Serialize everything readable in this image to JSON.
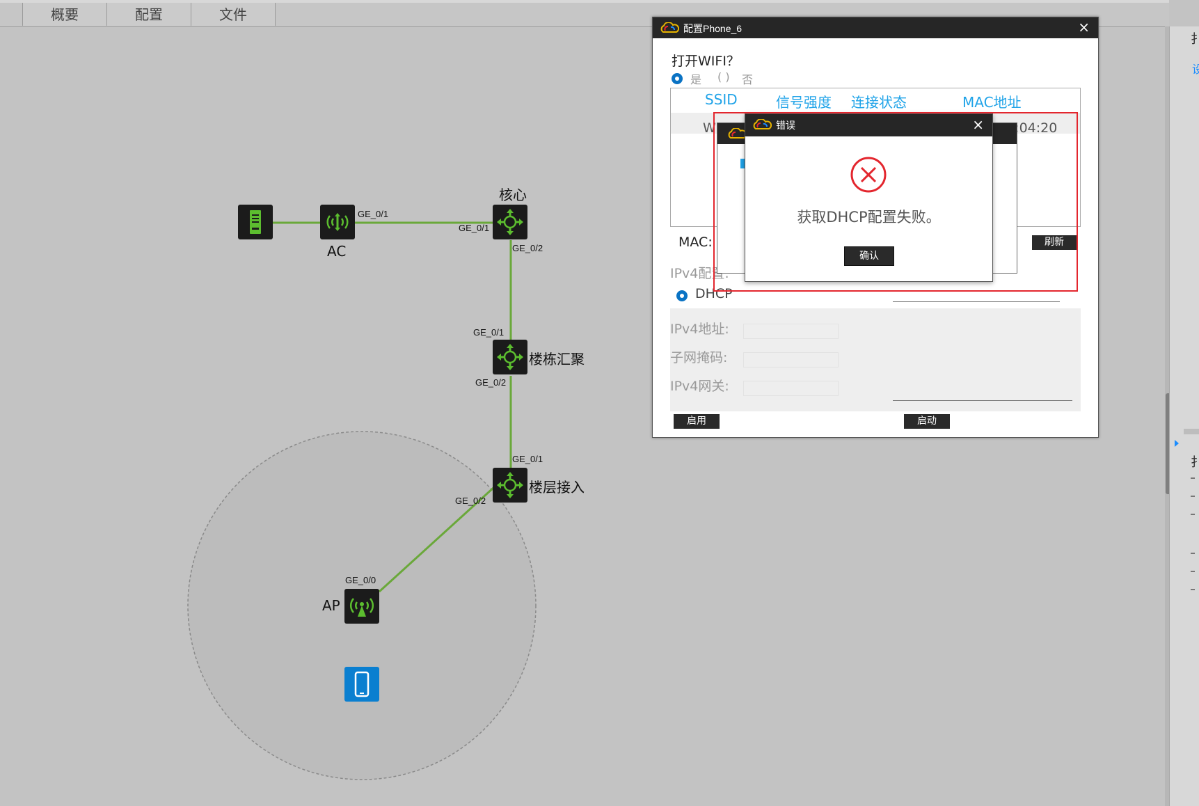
{
  "tabs": [
    "概要",
    "配置",
    "文件"
  ],
  "right_panel": {
    "top_char": "扌",
    "blue_char": "设",
    "mid_char": "扌"
  },
  "topology": {
    "devices": {
      "core_label": "核心",
      "ac_label": "AC",
      "building_label": "楼栋汇聚",
      "floor_label": "楼层接入",
      "ap_label": "AP"
    },
    "ports": {
      "ac_ge01": "GE_0/1",
      "core_ge01": "GE_0/1",
      "core_ge02": "GE_0/2",
      "bld_ge01": "GE_0/1",
      "bld_ge02": "GE_0/2",
      "flr_ge01": "GE_0/1",
      "flr_ge02": "GE_0/2",
      "ap_ge00": "GE_0/0"
    },
    "link_color": "#6aa83a"
  },
  "config_window": {
    "title": "配置Phone_6",
    "close": "×",
    "wifi_question": "打开WIFI？",
    "radio_yes": "是",
    "radio_no": "否",
    "table_headers": [
      "SSID",
      "信号强度",
      "连接状态",
      "MAC地址"
    ],
    "row_ssid_partial": "WLAN",
    "row_mac_partial": "00:04:20",
    "mac_label": "MAC:",
    "refresh_button": "刷新",
    "ipv4_config_label": "IPv4配置:",
    "dhcp_label": "DHCP",
    "ipv4_addr_label": "IPv4地址:",
    "subnet_label": "子网掩码:",
    "gateway_label": "IPv4网关:",
    "apply_button": "启用",
    "start_button": "启动"
  },
  "error_dialog": {
    "title": "错误",
    "close": "×",
    "message": "获取DHCP配置失败。",
    "ok_button": "确认"
  }
}
